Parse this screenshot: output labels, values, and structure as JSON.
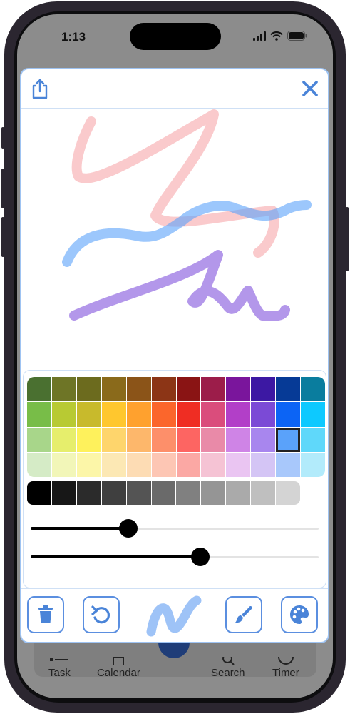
{
  "status": {
    "time": "1:13"
  },
  "background_tabs": [
    {
      "label": "Task"
    },
    {
      "label": "Calendar"
    },
    {
      "label": "Search"
    },
    {
      "label": "Timer"
    }
  ],
  "modal": {
    "share_icon": "share-icon",
    "close_icon": "close-icon"
  },
  "palette": {
    "rows": [
      [
        "#4a7030",
        "#6e7526",
        "#6c6b1e",
        "#8a6a1b",
        "#8b5418",
        "#8c3516",
        "#8a1414",
        "#9c1d4a",
        "#7a159c",
        "#3c18a3",
        "#063a96",
        "#0a7d9e"
      ],
      [
        "#78bd48",
        "#b8ca33",
        "#c8ba2c",
        "#ffc72e",
        "#ffa12e",
        "#fb662c",
        "#ef2d23",
        "#da4d7c",
        "#b23fc8",
        "#7b4ad6",
        "#0c64f5",
        "#0dc9ff"
      ],
      [
        "#a8d68a",
        "#e6ee6c",
        "#fef15c",
        "#fed56c",
        "#fdb76b",
        "#fd8f6a",
        "#fd6562",
        "#e98aa8",
        "#cf84e6",
        "#a886ee",
        "#5aa2fa",
        "#5fd8fa"
      ],
      [
        "#d5ebc6",
        "#f2f6b8",
        "#fcf6a8",
        "#fce8b4",
        "#fddcb4",
        "#fdc6b4",
        "#fba8a4",
        "#f5c3d4",
        "#eac5f2",
        "#d4c5f5",
        "#a8c8fb",
        "#b2ebfb"
      ]
    ],
    "selected": {
      "row": 2,
      "col": 10
    },
    "grays": [
      "#000000",
      "#171717",
      "#2b2b2b",
      "#3f3f3f",
      "#545454",
      "#6a6a6a",
      "#808080",
      "#959595",
      "#aaaaaa",
      "#bfbfbf",
      "#d4d4d4"
    ],
    "sliders": [
      {
        "name": "stroke-width-slider",
        "value": 0.34
      },
      {
        "name": "opacity-slider",
        "value": 0.59
      }
    ]
  },
  "toolbar": {
    "items": [
      {
        "name": "trash-button",
        "icon": "trash-icon"
      },
      {
        "name": "undo-button",
        "icon": "undo-icon"
      },
      {
        "name": "pen-preview",
        "icon": "stroke-preview-icon"
      },
      {
        "name": "brush-button",
        "icon": "brush-icon"
      },
      {
        "name": "palette-button",
        "icon": "palette-icon"
      }
    ],
    "accent": "#5b8fe0"
  },
  "strokes": [
    {
      "color": "#f7a7aa",
      "opacity": 0.6
    },
    {
      "color": "#5aa2fa",
      "opacity": 0.6
    },
    {
      "color": "#8a5fde",
      "opacity": 0.65
    }
  ]
}
